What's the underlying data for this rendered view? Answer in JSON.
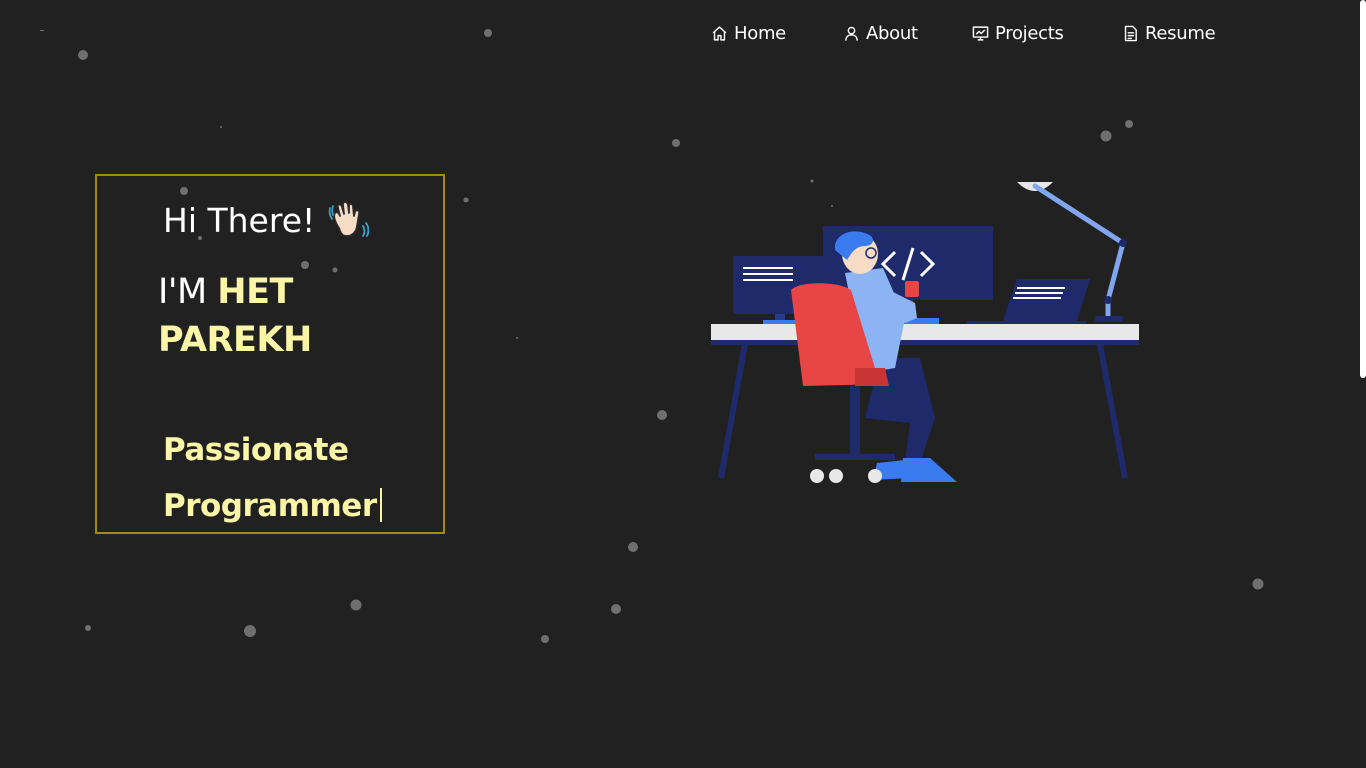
{
  "nav": {
    "items": [
      {
        "label": "Home",
        "icon": "home-icon"
      },
      {
        "label": "About",
        "icon": "user-icon"
      },
      {
        "label": "Projects",
        "icon": "presentation-icon"
      },
      {
        "label": "Resume",
        "icon": "document-icon"
      }
    ]
  },
  "hero": {
    "greeting": "Hi There!",
    "name_prefix": "I'M",
    "name_first": "HET",
    "name_last": "PAREKH",
    "typed_line1": "Passionate",
    "typed_line2": "Programmer"
  },
  "colors": {
    "background": "#212121",
    "highlight": "#fbf6a7",
    "box_border": "#a58a12",
    "nav_text": "#ffffff"
  }
}
